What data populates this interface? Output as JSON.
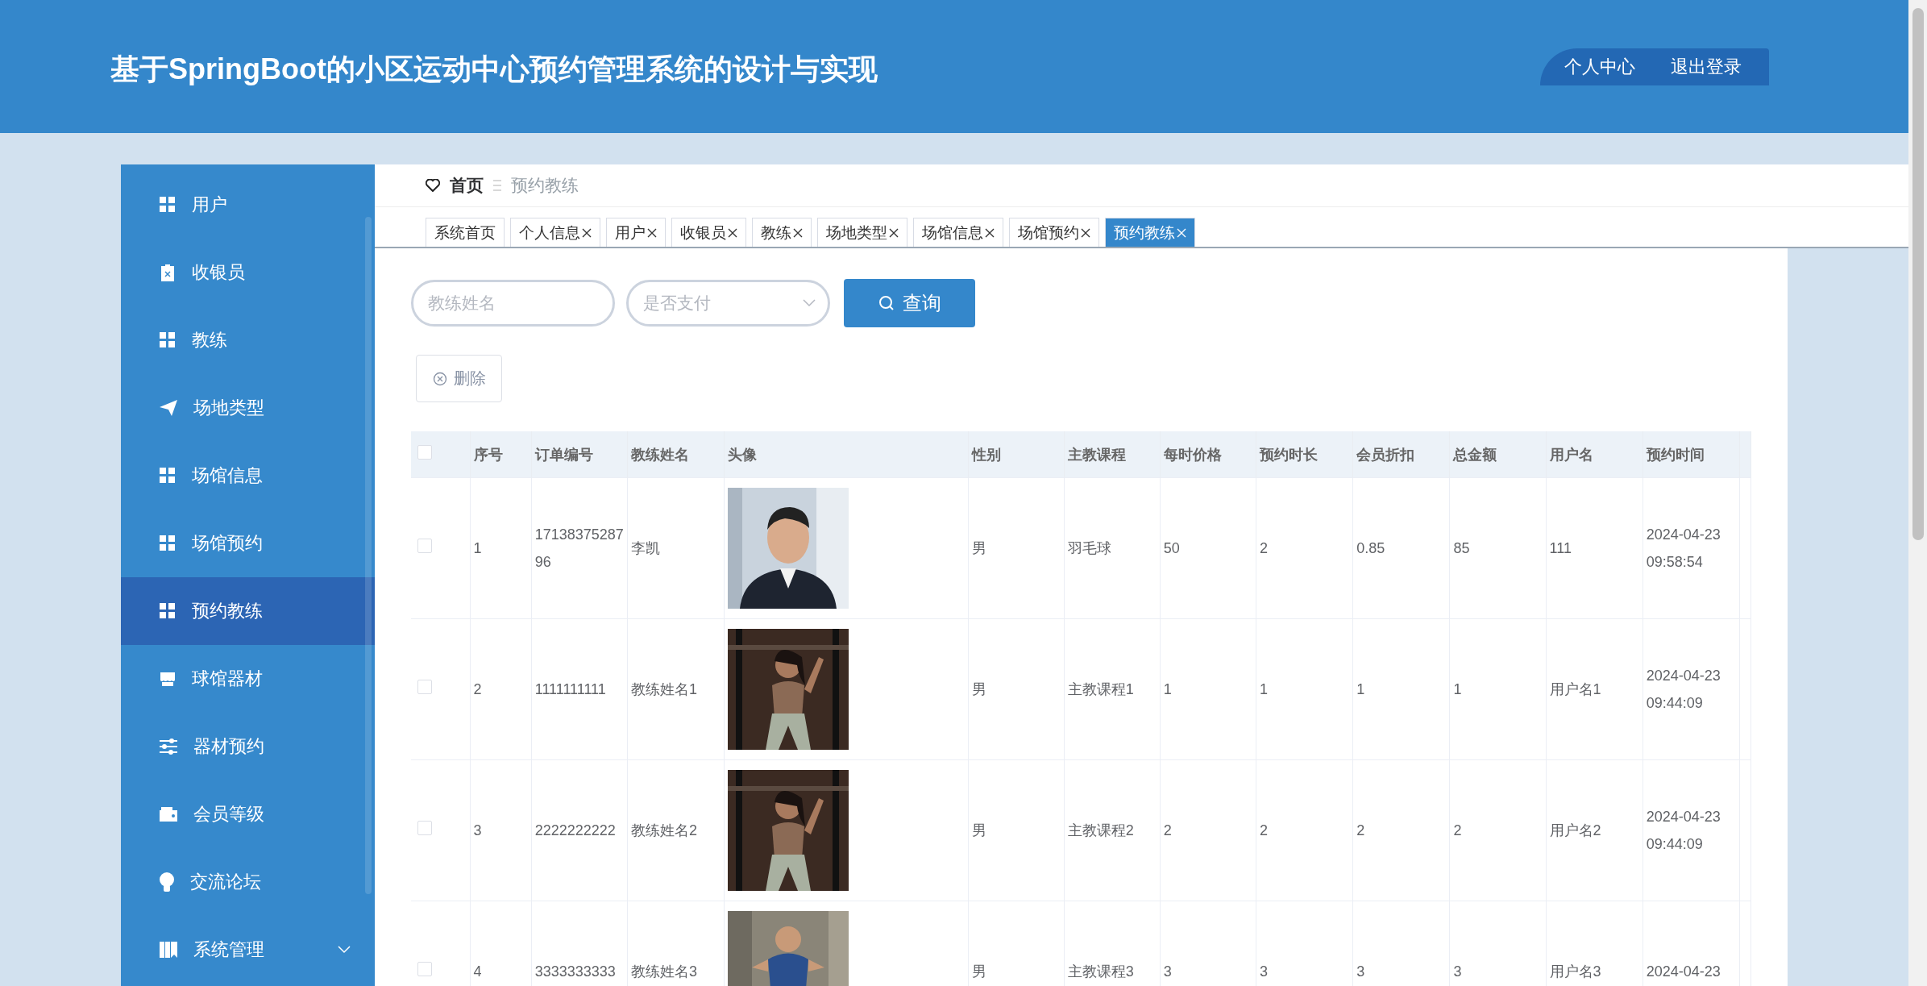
{
  "header": {
    "title": "基于SpringBoot的小区运动中心预约管理系统的设计与实现",
    "links": [
      "个人中心",
      "退出登录"
    ]
  },
  "sidebar": {
    "items": [
      {
        "label": "用户",
        "selected": false,
        "kind": "item"
      },
      {
        "label": "收银员",
        "selected": false,
        "kind": "item"
      },
      {
        "label": "教练",
        "selected": false,
        "kind": "item"
      },
      {
        "label": "场地类型",
        "selected": false,
        "kind": "item"
      },
      {
        "label": "场馆信息",
        "selected": false,
        "kind": "item"
      },
      {
        "label": "场馆预约",
        "selected": false,
        "kind": "item"
      },
      {
        "label": "预约教练",
        "selected": true,
        "kind": "item"
      },
      {
        "label": "球馆器材",
        "selected": false,
        "kind": "item"
      },
      {
        "label": "器材预约",
        "selected": false,
        "kind": "item"
      },
      {
        "label": "会员等级",
        "selected": false,
        "kind": "item"
      },
      {
        "label": "交流论坛",
        "selected": false,
        "kind": "item"
      },
      {
        "label": "系统管理",
        "selected": false,
        "kind": "submenu"
      }
    ]
  },
  "breadcrumb": {
    "home": "首页",
    "current": "预约教练"
  },
  "tabs": [
    {
      "label": "系统首页",
      "closable": false,
      "selected": false
    },
    {
      "label": "个人信息",
      "closable": true,
      "selected": false
    },
    {
      "label": "用户",
      "closable": true,
      "selected": false
    },
    {
      "label": "收银员",
      "closable": true,
      "selected": false
    },
    {
      "label": "教练",
      "closable": true,
      "selected": false
    },
    {
      "label": "场地类型",
      "closable": true,
      "selected": false
    },
    {
      "label": "场馆信息",
      "closable": true,
      "selected": false
    },
    {
      "label": "场馆预约",
      "closable": true,
      "selected": false
    },
    {
      "label": "预约教练",
      "closable": true,
      "selected": true
    }
  ],
  "search": {
    "name_placeholder": "教练姓名",
    "paid_placeholder": "是否支付",
    "button": "查询"
  },
  "delete_button": "删除",
  "table": {
    "all_checked": false,
    "columns": [
      "序号",
      "订单编号",
      "教练姓名",
      "头像",
      "性别",
      "主教课程",
      "每时价格",
      "预约时长",
      "会员折扣",
      "总金额",
      "用户名",
      "预约时间"
    ],
    "rows": [
      {
        "checked": false,
        "index": "1",
        "order": "1713837528796",
        "coach": "李凯",
        "gender": "男",
        "course": "羽毛球",
        "price": "50",
        "duration": "2",
        "discount": "0.85",
        "total": "85",
        "user": "111",
        "time": "2024-04-23 09:58:54"
      },
      {
        "checked": false,
        "index": "2",
        "order": "1111111111",
        "coach": "教练姓名1",
        "gender": "男",
        "course": "主教课程1",
        "price": "1",
        "duration": "1",
        "discount": "1",
        "total": "1",
        "user": "用户名1",
        "time": "2024-04-23 09:44:09"
      },
      {
        "checked": false,
        "index": "3",
        "order": "2222222222",
        "coach": "教练姓名2",
        "gender": "男",
        "course": "主教课程2",
        "price": "2",
        "duration": "2",
        "discount": "2",
        "total": "2",
        "user": "用户名2",
        "time": "2024-04-23 09:44:09"
      },
      {
        "checked": false,
        "index": "4",
        "order": "3333333333",
        "coach": "教练姓名3",
        "gender": "男",
        "course": "主教课程3",
        "price": "3",
        "duration": "3",
        "discount": "3",
        "total": "3",
        "user": "用户名3",
        "time": "2024-04-23"
      }
    ]
  }
}
